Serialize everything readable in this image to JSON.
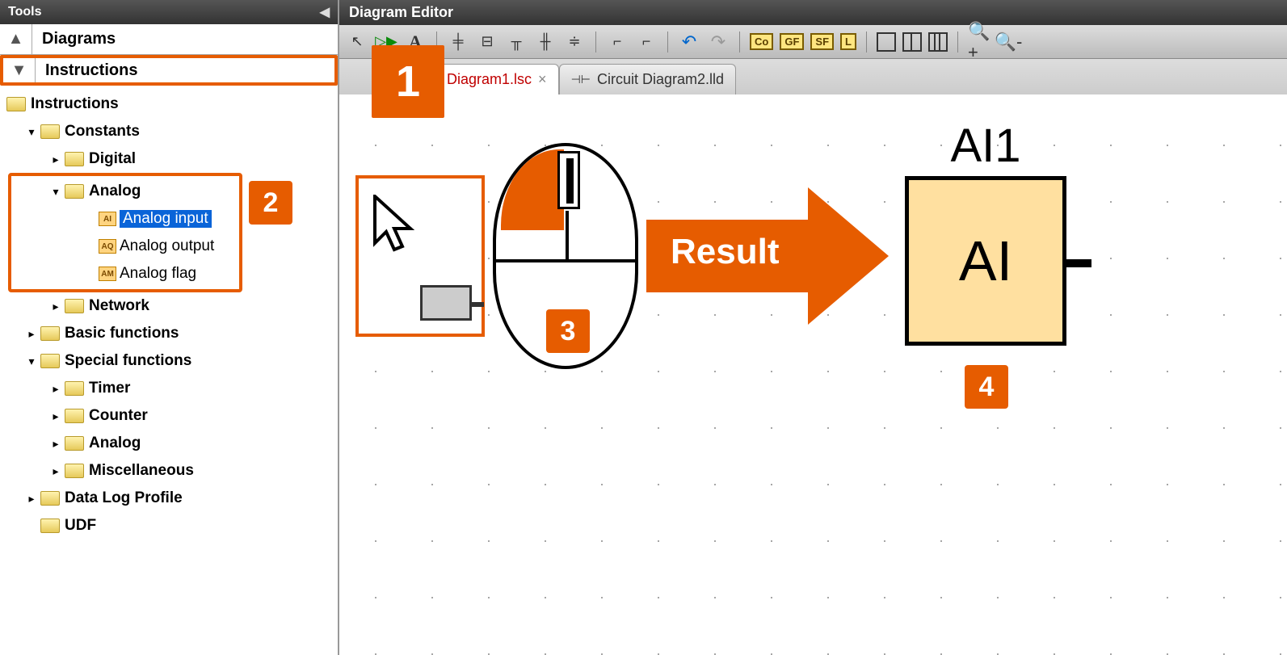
{
  "sidebar": {
    "title": "Tools",
    "sections": {
      "diagrams": "Diagrams",
      "instructions": "Instructions"
    },
    "root": "Instructions",
    "tree": {
      "constants": "Constants",
      "digital": "Digital",
      "analog": "Analog",
      "analog_input": "Analog input",
      "analog_output": "Analog output",
      "analog_flag": "Analog flag",
      "network": "Network",
      "basic_functions": "Basic functions",
      "special_functions": "Special functions",
      "timer": "Timer",
      "counter": "Counter",
      "analog2": "Analog",
      "misc": "Miscellaneous",
      "data_log": "Data Log Profile",
      "udf": "UDF"
    },
    "icons": {
      "ai": "AI",
      "aq": "AQ",
      "am": "AM"
    }
  },
  "editor": {
    "title": "Diagram Editor",
    "tabs": {
      "tab1": "uit Diagram1.lsc",
      "tab2": "Circuit Diagram2.lld"
    },
    "toolbar": {
      "text": "A",
      "co": "Co",
      "gf": "GF",
      "sf": "SF",
      "l": "L"
    }
  },
  "canvas": {
    "arrow_label": "Result",
    "block_title": "AI1",
    "block_text": "AI"
  },
  "callouts": {
    "c1": "1",
    "c2": "2",
    "c3": "3",
    "c4": "4"
  }
}
